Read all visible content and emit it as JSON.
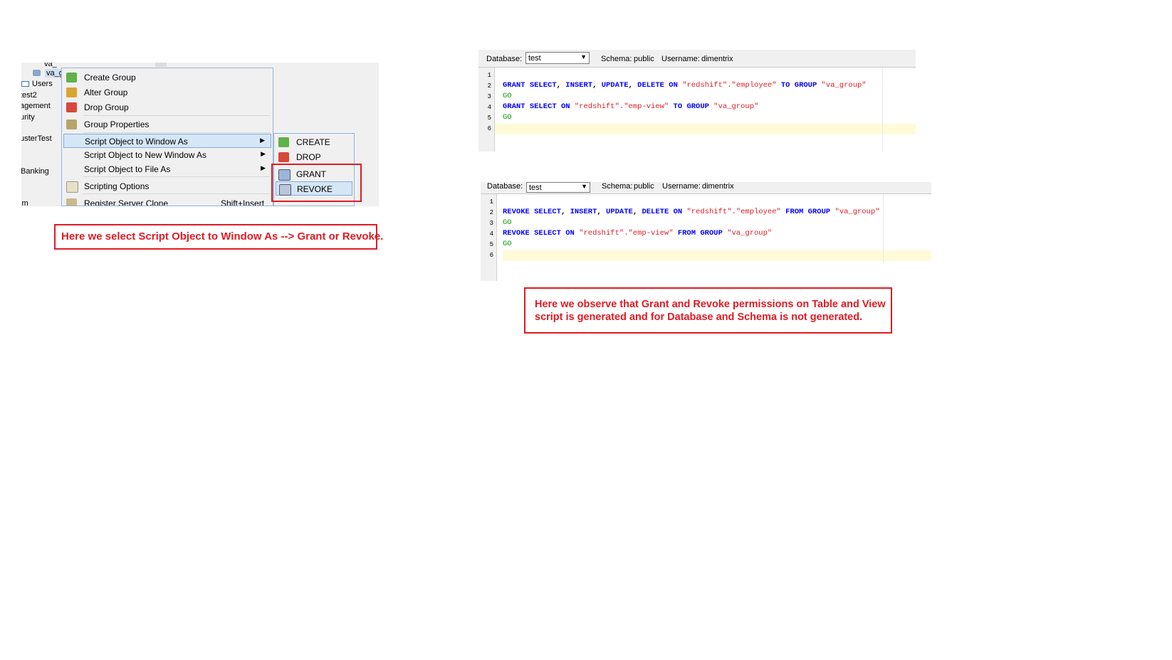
{
  "object_explorer": {
    "nodes": [
      "va_",
      "va_g",
      "Users",
      "test2",
      "agement",
      "urity",
      "usterTest",
      "Banking",
      "im"
    ]
  },
  "context_menu": {
    "items": [
      {
        "label": "Create Group",
        "icon": "create-group-icon"
      },
      {
        "label": "Alter Group",
        "icon": "alter-group-icon"
      },
      {
        "label": "Drop Group",
        "icon": "drop-group-icon"
      },
      {
        "label": "Group Properties",
        "icon": "group-properties-icon"
      },
      {
        "label": "Script Object to Window As",
        "has_submenu": true
      },
      {
        "label": "Script Object to New Window As",
        "has_submenu": true
      },
      {
        "label": "Script Object to File As",
        "has_submenu": true
      },
      {
        "label": "Scripting Options",
        "icon": "scripting-options-icon"
      },
      {
        "label": "Register Server Clone",
        "shortcut": "Shift+Insert",
        "icon": "register-clone-icon"
      }
    ]
  },
  "submenu": {
    "items": [
      {
        "label": "CREATE"
      },
      {
        "label": "DROP"
      },
      {
        "label": "GRANT"
      },
      {
        "label": "REVOKE"
      }
    ]
  },
  "note_left": "Here  we select Script Object to Window As --> Grant or Revoke.",
  "editor_grant": {
    "database_label": "Database:",
    "database_value": "test",
    "schema_label": "Schema:",
    "schema_value": "public",
    "username_label": "Username:",
    "username_value": "dimentrix",
    "line_numbers": [
      "1",
      "2",
      "3",
      "4",
      "5",
      "6"
    ]
  },
  "editor_revoke": {
    "database_label": "Database:",
    "database_value": "test",
    "schema_label": "Schema:",
    "schema_value": "public",
    "username_label": "Username:",
    "username_value": "dimentrix",
    "line_numbers": [
      "1",
      "2",
      "3",
      "4",
      "5",
      "6"
    ]
  },
  "code_tokens": {
    "grant": "GRANT",
    "revoke": "REVOKE",
    "select": "SELECT",
    "insert": "INSERT",
    "update": "UPDATE",
    "delete": "DELETE",
    "on": "ON",
    "to": "TO",
    "from": "FROM",
    "group": "GROUP",
    "go": "GO",
    "comma": ",",
    "dot": ".",
    "redshift": "\"redshift\"",
    "employee": "\"employee\"",
    "emp_view": "\"emp-view\"",
    "va_group": "\"va_group\""
  },
  "note_right_line1": "Here we observe that Grant and Revoke permissions on Table and View",
  "note_right_line2": "script is generated and for Database and Schema is not generated.",
  "colors": {
    "annotation_red": "#e01b24",
    "keyword_blue": "#0000ff",
    "go_green": "#0a9a0a"
  }
}
